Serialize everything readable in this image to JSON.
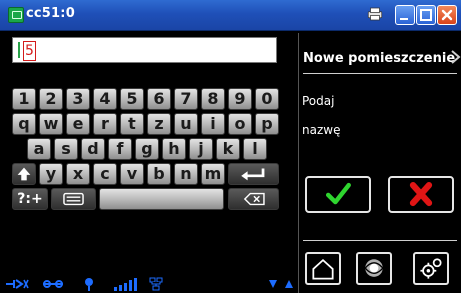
{
  "window": {
    "title": "cc51:0"
  },
  "input": {
    "value": "5"
  },
  "keyboard": {
    "row1": [
      "1",
      "2",
      "3",
      "4",
      "5",
      "6",
      "7",
      "8",
      "9",
      "0"
    ],
    "row2": [
      "q",
      "w",
      "e",
      "r",
      "t",
      "z",
      "u",
      "i",
      "o",
      "p"
    ],
    "row3": [
      "a",
      "s",
      "d",
      "f",
      "g",
      "h",
      "j",
      "k",
      "l"
    ],
    "row4": [
      "y",
      "x",
      "c",
      "v",
      "b",
      "n",
      "m"
    ],
    "mode_label": "?:+"
  },
  "panel": {
    "title": "Nowe pomieszczenie",
    "prompt_line1": "Podaj",
    "prompt_line2": "nazwę"
  },
  "colors": {
    "accent_ok": "#2fd52f",
    "accent_cancel": "#e01515",
    "status_blue": "#1d6cff"
  },
  "icons": {
    "ok": "checkmark-icon",
    "cancel": "x-icon",
    "home": "home-icon",
    "eye": "eye-icon",
    "settings": "gears-icon"
  }
}
